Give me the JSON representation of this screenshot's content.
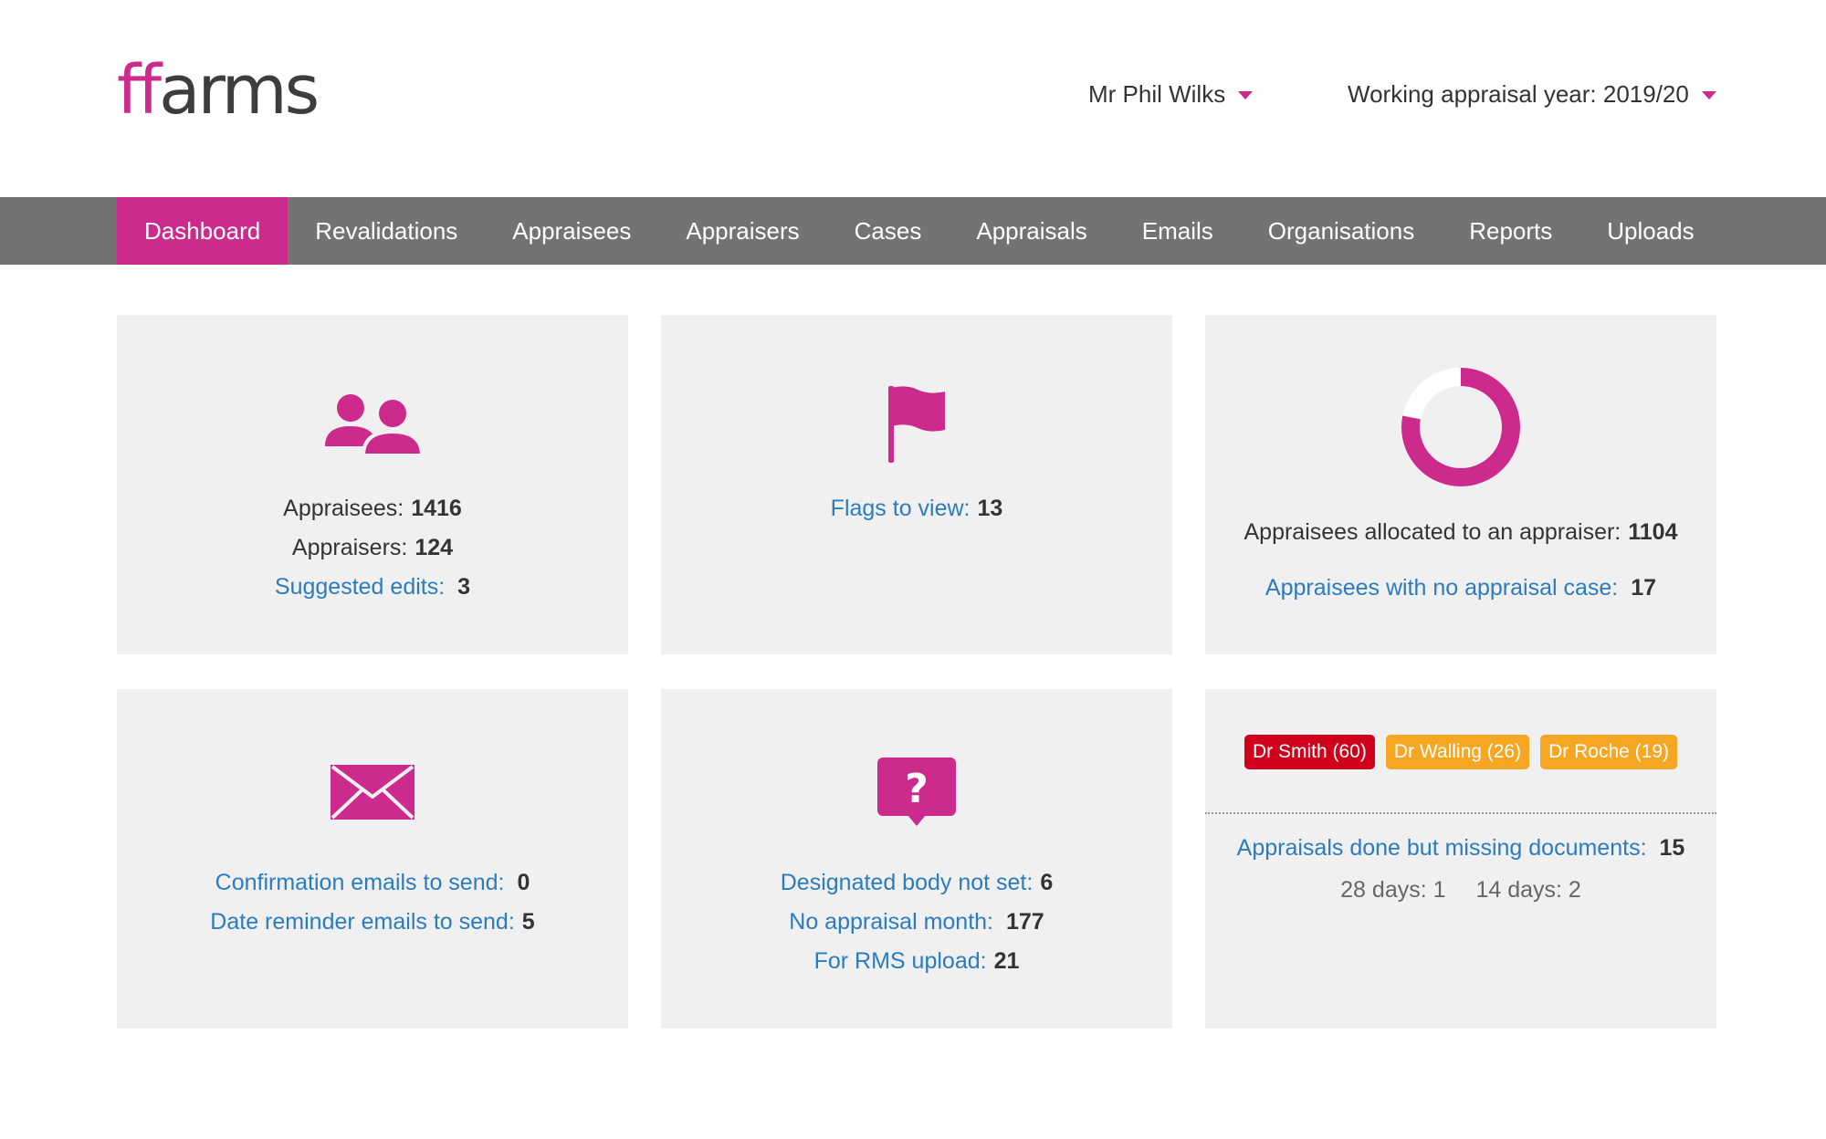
{
  "header": {
    "logo_a": "ff",
    "logo_b": "arms",
    "user_name": "Mr Phil Wilks",
    "appraisal_year": "Working appraisal year: 2019/20"
  },
  "nav": {
    "items": [
      {
        "label": "Dashboard"
      },
      {
        "label": "Revalidations"
      },
      {
        "label": "Appraisees"
      },
      {
        "label": "Appraisers"
      },
      {
        "label": "Cases"
      },
      {
        "label": "Appraisals"
      },
      {
        "label": "Emails"
      },
      {
        "label": "Organisations"
      },
      {
        "label": "Reports"
      },
      {
        "label": "Uploads"
      }
    ]
  },
  "cards": {
    "people": {
      "appraisees_label": "Appraisees:",
      "appraisees_value": "1416",
      "appraisers_label": "Appraisers:",
      "appraisers_value": "124",
      "suggested_label": "Suggested edits:",
      "suggested_value": "3"
    },
    "flags": {
      "flags_label": "Flags to view:",
      "flags_value": "13"
    },
    "allocation": {
      "progress_fraction": 0.78,
      "allocated_label": "Appraisees allocated to an appraiser:",
      "allocated_value": "1104",
      "nocase_label": "Appraisees with no appraisal case:",
      "nocase_value": "17"
    },
    "emails": {
      "confirm_label": "Confirmation emails to send:",
      "confirm_value": "0",
      "reminder_label": "Date reminder emails to send:",
      "reminder_value": "5"
    },
    "queries": {
      "body_label": "Designated body not set:",
      "body_value": "6",
      "month_label": "No appraisal month:",
      "month_value": "177",
      "rms_label": "For RMS upload:",
      "rms_value": "21"
    },
    "missing": {
      "tags": [
        {
          "label": "Dr Smith (60)",
          "color": "#d0021b"
        },
        {
          "label": "Dr Walling (26)",
          "color": "#f5a623"
        },
        {
          "label": "Dr Roche (19)",
          "color": "#f5a623"
        }
      ],
      "missing_label": "Appraisals done but missing documents:",
      "missing_value": "15",
      "days28": "28 days: 1",
      "days14": "14 days: 2"
    }
  },
  "colors": {
    "accent": "#cc2a8c",
    "link": "#2b7cbf",
    "nav_bg": "#737373",
    "card_bg": "#f0f0f0"
  }
}
